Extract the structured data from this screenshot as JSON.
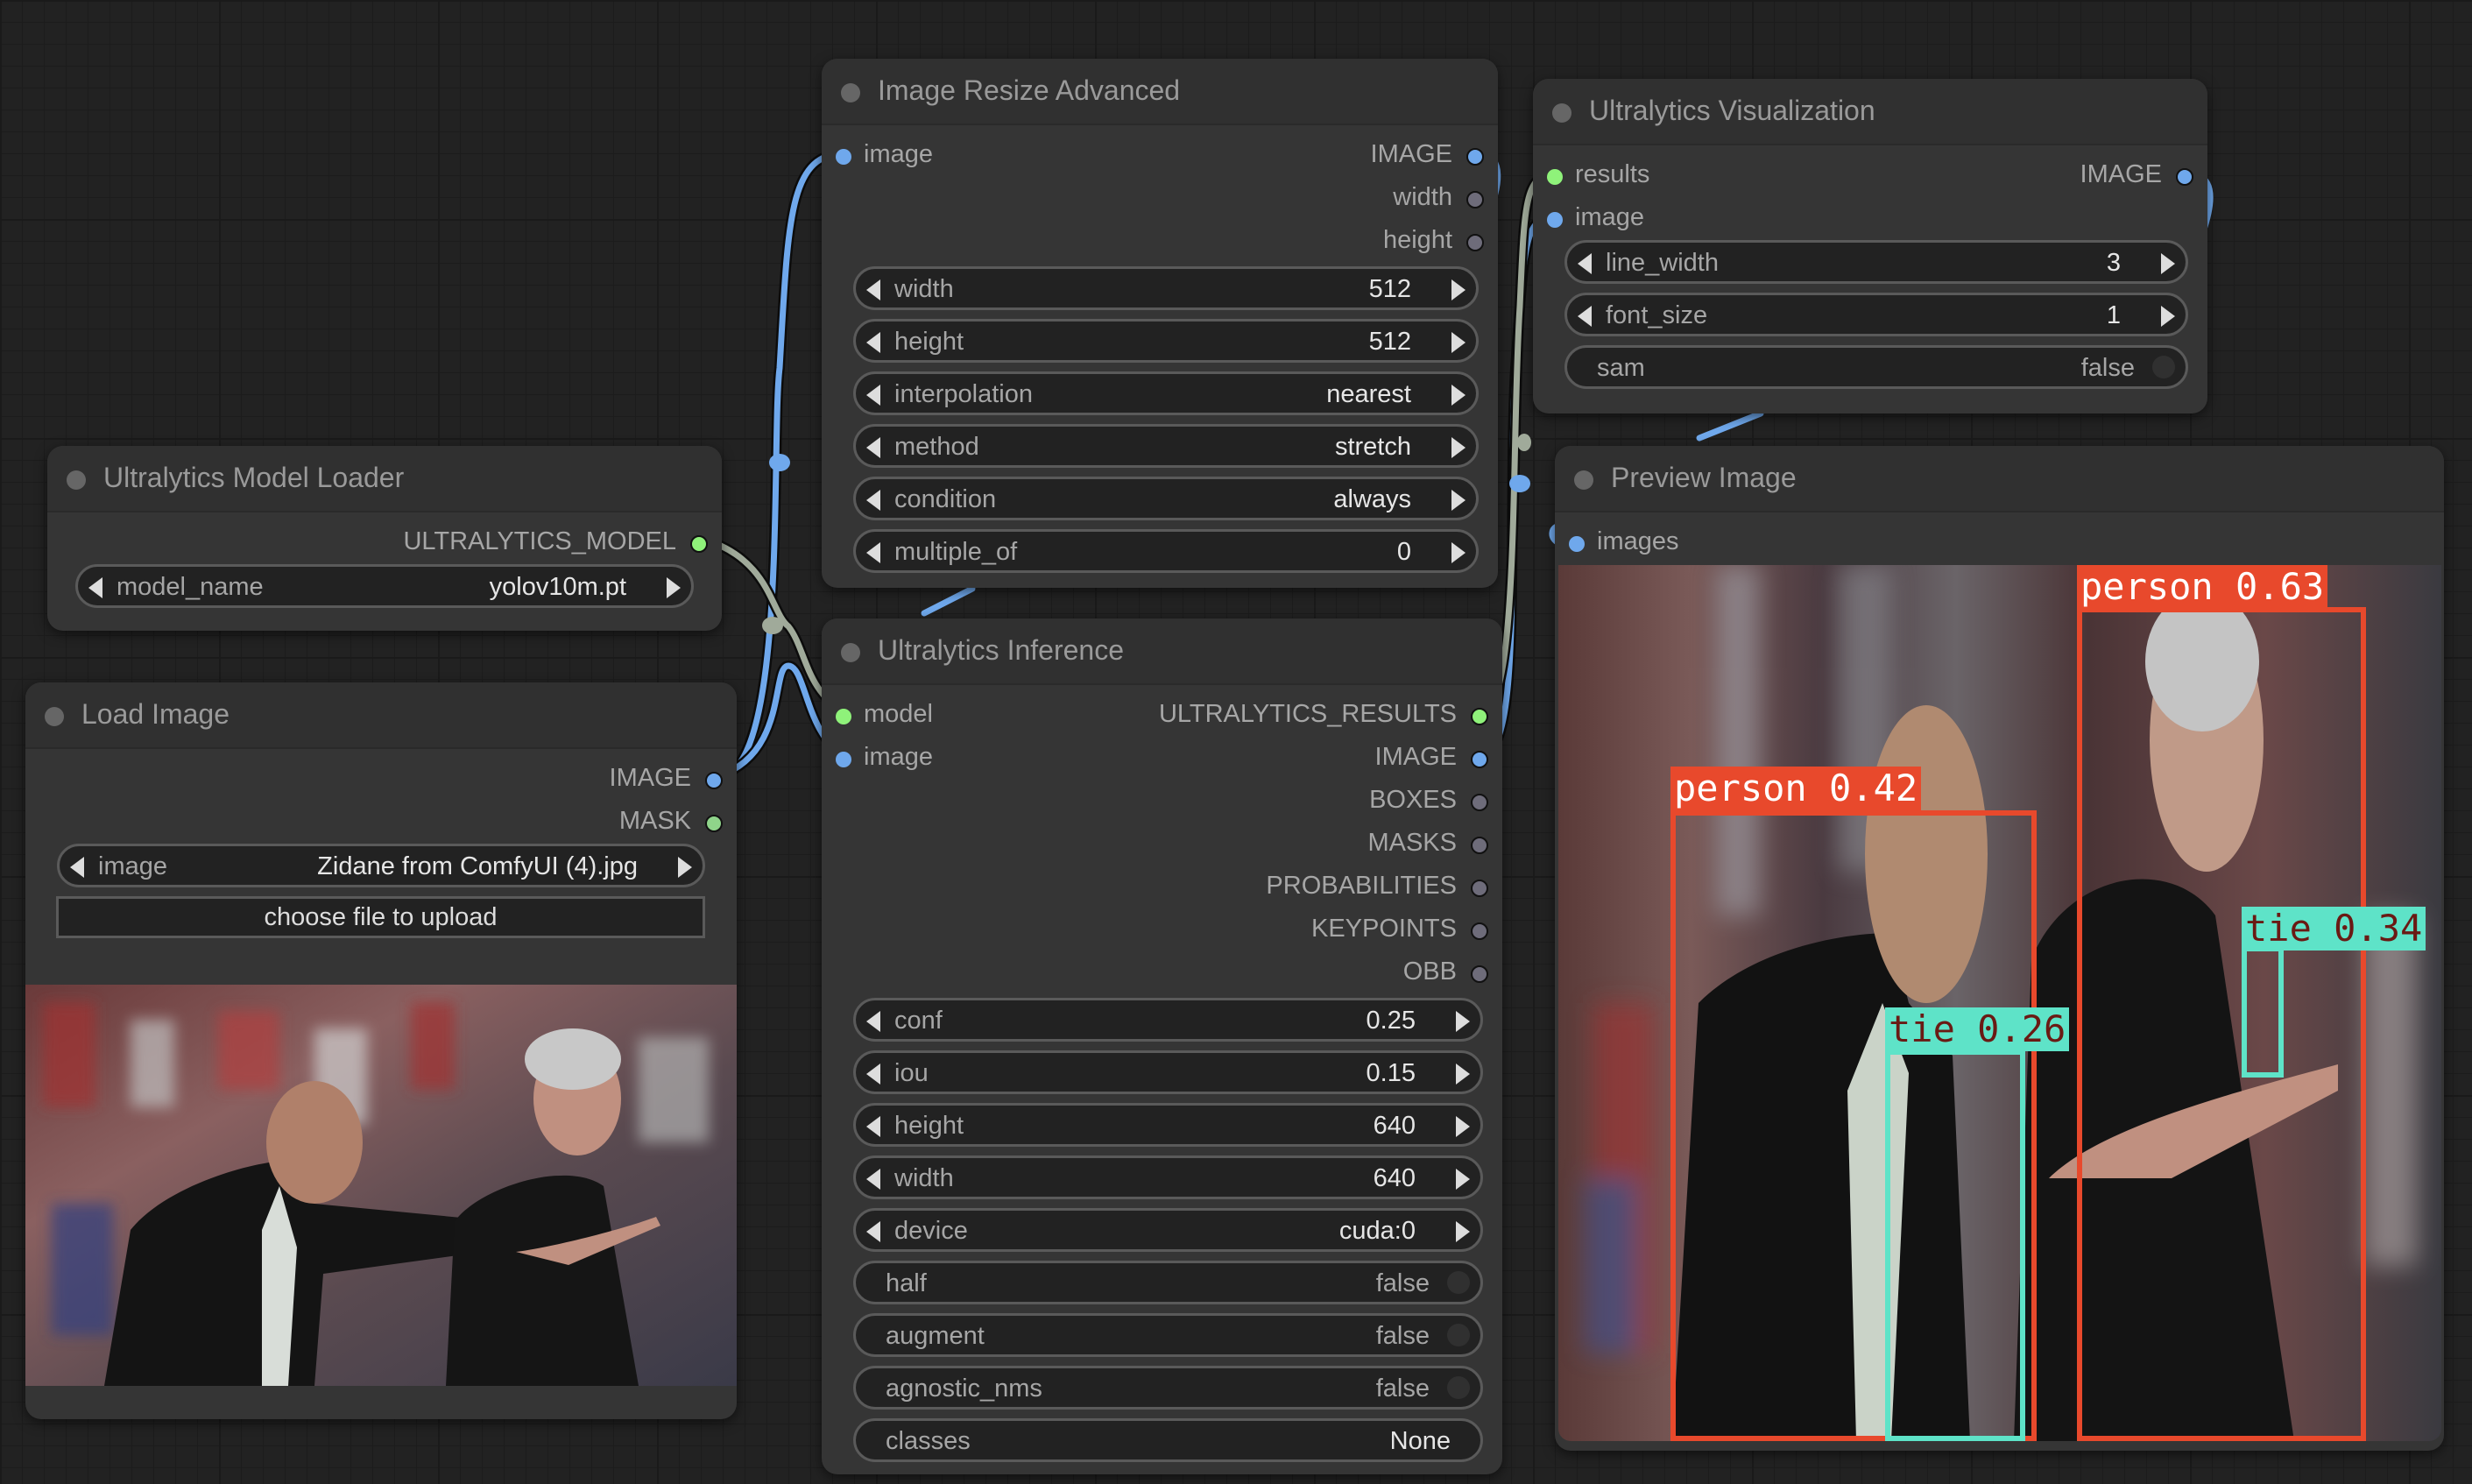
{
  "nodes": {
    "model_loader": {
      "title": "Ultralytics Model Loader",
      "outputs": [
        {
          "label": "ULTRALYTICS_MODEL",
          "type": "model"
        }
      ],
      "widgets": [
        {
          "label": "model_name",
          "value": "yolov10m.pt",
          "kind": "combo"
        }
      ]
    },
    "load_image": {
      "title": "Load Image",
      "outputs": [
        {
          "label": "IMAGE",
          "type": "image"
        },
        {
          "label": "MASK",
          "type": "mask"
        }
      ],
      "widgets": [
        {
          "label": "image",
          "value": "Zidane from ComfyUI (4).jpg",
          "kind": "combo"
        }
      ],
      "upload_button": "choose file to upload",
      "preview_alt": "Two football coaches on the sideline"
    },
    "resize": {
      "title": "Image Resize Advanced",
      "inputs": [
        {
          "label": "image",
          "type": "image"
        }
      ],
      "outputs": [
        {
          "label": "IMAGE",
          "type": "image"
        },
        {
          "label": "width",
          "type": "int"
        },
        {
          "label": "height",
          "type": "int"
        }
      ],
      "widgets": [
        {
          "label": "width",
          "value": "512"
        },
        {
          "label": "height",
          "value": "512"
        },
        {
          "label": "interpolation",
          "value": "nearest"
        },
        {
          "label": "method",
          "value": "stretch"
        },
        {
          "label": "condition",
          "value": "always"
        },
        {
          "label": "multiple_of",
          "value": "0"
        }
      ]
    },
    "inference": {
      "title": "Ultralytics Inference",
      "inputs": [
        {
          "label": "model",
          "type": "model"
        },
        {
          "label": "image",
          "type": "image"
        }
      ],
      "outputs": [
        {
          "label": "ULTRALYTICS_RESULTS",
          "type": "model"
        },
        {
          "label": "IMAGE",
          "type": "image"
        },
        {
          "label": "BOXES",
          "type": "other"
        },
        {
          "label": "MASKS",
          "type": "other"
        },
        {
          "label": "PROBABILITIES",
          "type": "other"
        },
        {
          "label": "KEYPOINTS",
          "type": "other"
        },
        {
          "label": "OBB",
          "type": "other"
        }
      ],
      "widgets": [
        {
          "label": "conf",
          "value": "0.25"
        },
        {
          "label": "iou",
          "value": "0.15"
        },
        {
          "label": "height",
          "value": "640"
        },
        {
          "label": "width",
          "value": "640"
        },
        {
          "label": "device",
          "value": "cuda:0"
        }
      ],
      "toggles": [
        {
          "label": "half",
          "value": "false"
        },
        {
          "label": "augment",
          "value": "false"
        },
        {
          "label": "agnostic_nms",
          "value": "false"
        }
      ],
      "text_widgets": [
        {
          "label": "classes",
          "value": "None"
        }
      ]
    },
    "visualization": {
      "title": "Ultralytics Visualization",
      "inputs": [
        {
          "label": "results",
          "type": "model"
        },
        {
          "label": "image",
          "type": "image"
        }
      ],
      "outputs": [
        {
          "label": "IMAGE",
          "type": "image"
        }
      ],
      "widgets": [
        {
          "label": "line_width",
          "value": "3"
        },
        {
          "label": "font_size",
          "value": "1"
        }
      ],
      "toggles": [
        {
          "label": "sam",
          "value": "false"
        }
      ]
    },
    "preview": {
      "title": "Preview Image",
      "inputs": [
        {
          "label": "images",
          "type": "image"
        }
      ],
      "detections": [
        {
          "label": "person 0.42",
          "class": "person",
          "confidence": 0.42
        },
        {
          "label": "person 0.63",
          "class": "person",
          "confidence": 0.63
        },
        {
          "label": "tie 0.26",
          "class": "tie",
          "confidence": 0.26
        },
        {
          "label": "tie 0.34",
          "class": "tie",
          "confidence": 0.34
        }
      ]
    }
  },
  "colors": {
    "image_slot": "#6fa8ec",
    "model_slot": "#8ff27a",
    "mask_slot": "#8fd48a",
    "other_slot": "#6e6c7a",
    "person_box": "#e8492c",
    "tie_box": "#5ee3c8",
    "wire_image": "#6fa8ec",
    "wire_model": "#a0aa9a"
  }
}
